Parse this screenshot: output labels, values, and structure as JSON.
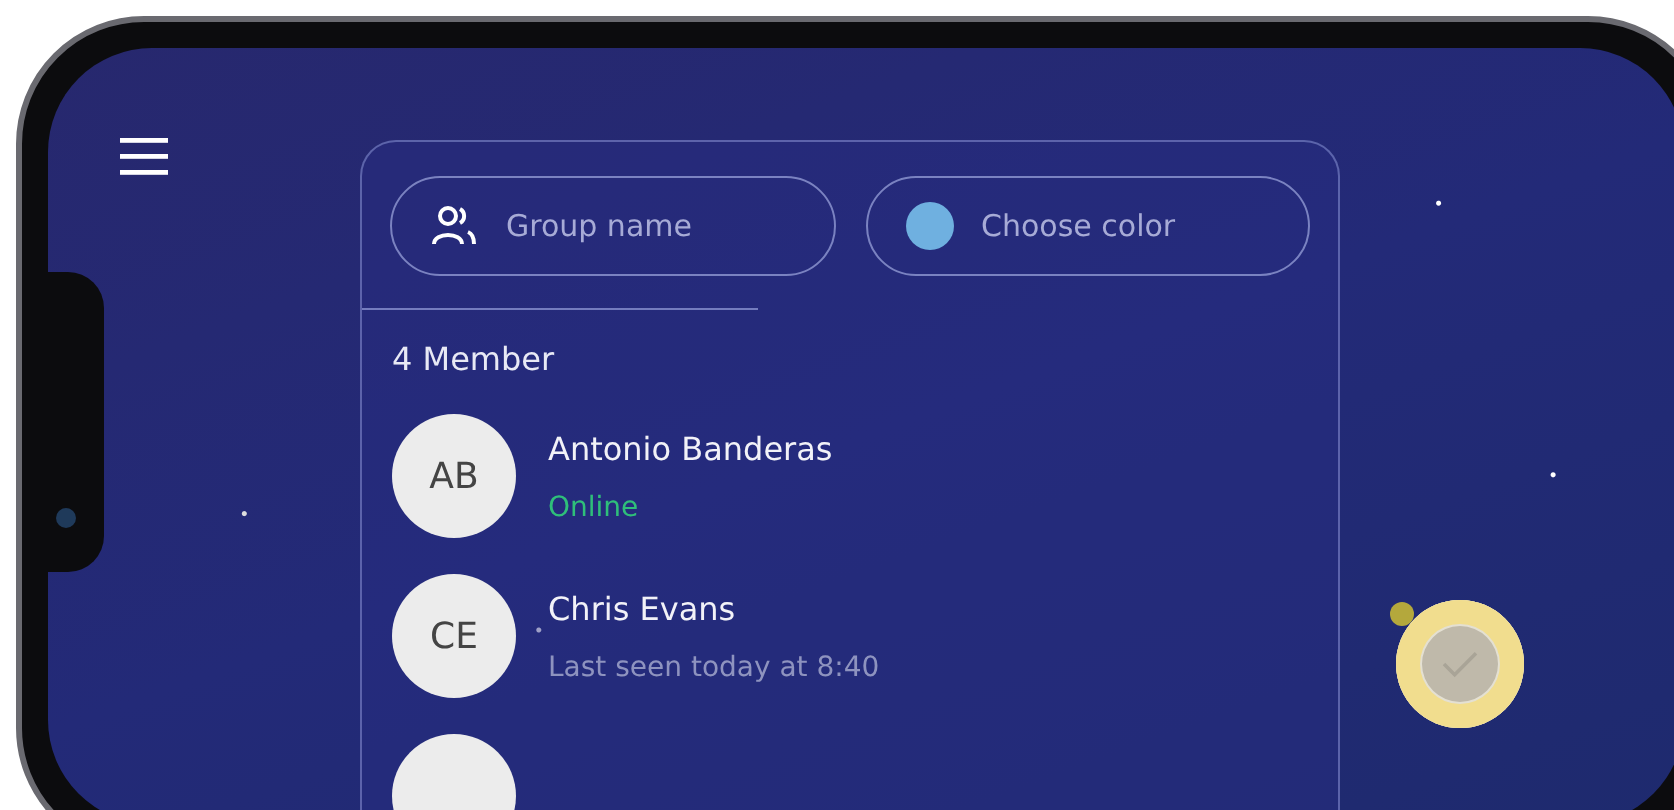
{
  "group_name_field": {
    "placeholder": "Group name"
  },
  "color_field": {
    "placeholder": "Choose color",
    "color": "#6fb0e0"
  },
  "member_count": "4 Member",
  "members": [
    {
      "initials": "AB",
      "name": "Antonio Banderas",
      "status": "Online",
      "online": true
    },
    {
      "initials": "CE",
      "name": "Chris Evans",
      "status": "Last seen today at 8:40",
      "online": false
    }
  ]
}
